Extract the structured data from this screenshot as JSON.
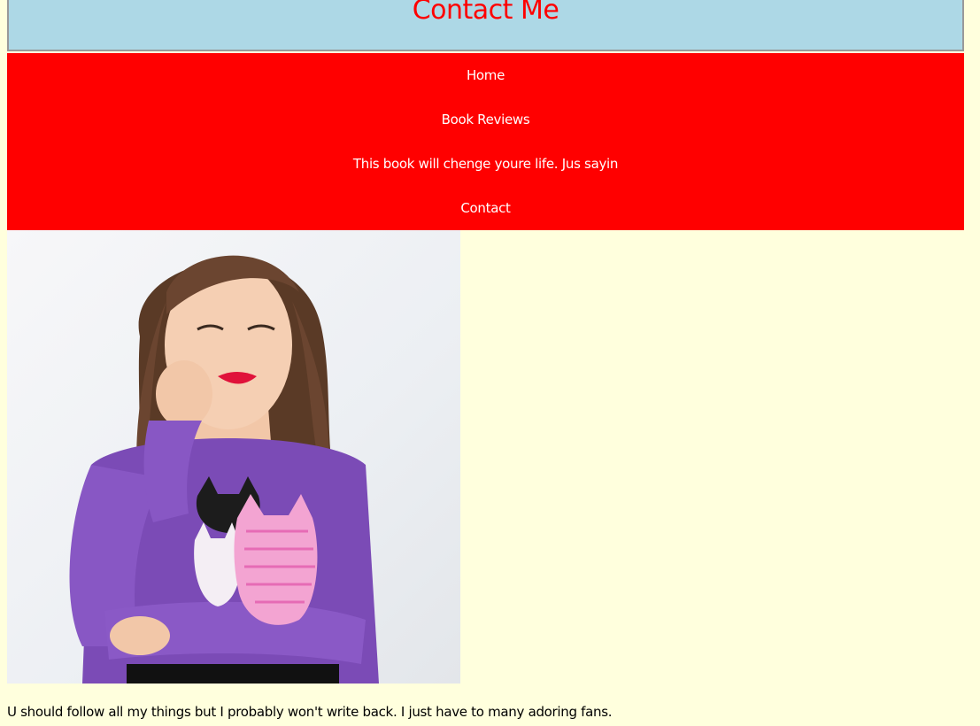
{
  "header": {
    "title": "Contact Me"
  },
  "nav": {
    "items": [
      {
        "label": "Home"
      },
      {
        "label": "Book Reviews"
      },
      {
        "label": "This book will chenge youre life. Jus sayin"
      },
      {
        "label": "Contact"
      }
    ]
  },
  "main": {
    "photo_subject": "woman in purple cat sweater",
    "caption": "U should follow all my things but I probably won't write back. I just have to many adoring fans."
  },
  "colors": {
    "page_background": "#ffffdd",
    "header_background": "#add8e6",
    "header_text": "#ff0000",
    "nav_background": "#ff0000",
    "nav_text": "#ffffff"
  }
}
